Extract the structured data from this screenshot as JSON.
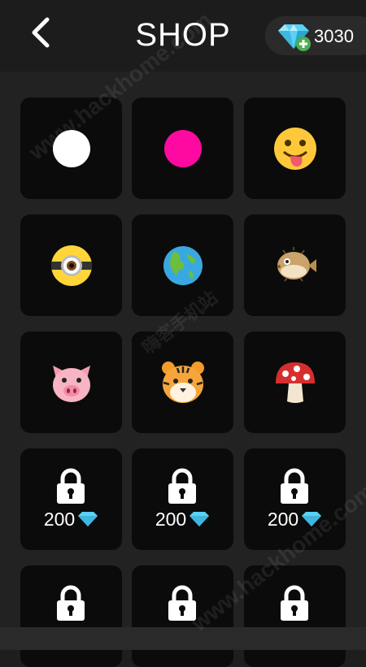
{
  "header": {
    "title": "SHOP",
    "gem_count": "3030"
  },
  "items": [
    {
      "icon": "white-circle-icon"
    },
    {
      "icon": "pink-circle-icon"
    },
    {
      "icon": "tongue-face-emoji-icon"
    },
    {
      "icon": "minion-eye-icon"
    },
    {
      "icon": "earth-globe-icon"
    },
    {
      "icon": "blowfish-icon"
    },
    {
      "icon": "pig-face-icon"
    },
    {
      "icon": "tiger-face-icon"
    },
    {
      "icon": "mushroom-icon"
    },
    {
      "locked": true,
      "price": "200"
    },
    {
      "locked": true,
      "price": "200"
    },
    {
      "locked": true,
      "price": "200"
    },
    {
      "locked": true
    },
    {
      "locked": true
    },
    {
      "locked": true
    }
  ],
  "watermark": {
    "text1": "www.hackhome.com",
    "text2": "嗨客手机站",
    "text3": "www.hackhome.com"
  },
  "colors": {
    "background": "#1e1e1e",
    "cell": "#0b0b0b",
    "gem": "#5ad1f5",
    "gem_plus": "#4caf50",
    "pink": "#ff0aa0"
  }
}
